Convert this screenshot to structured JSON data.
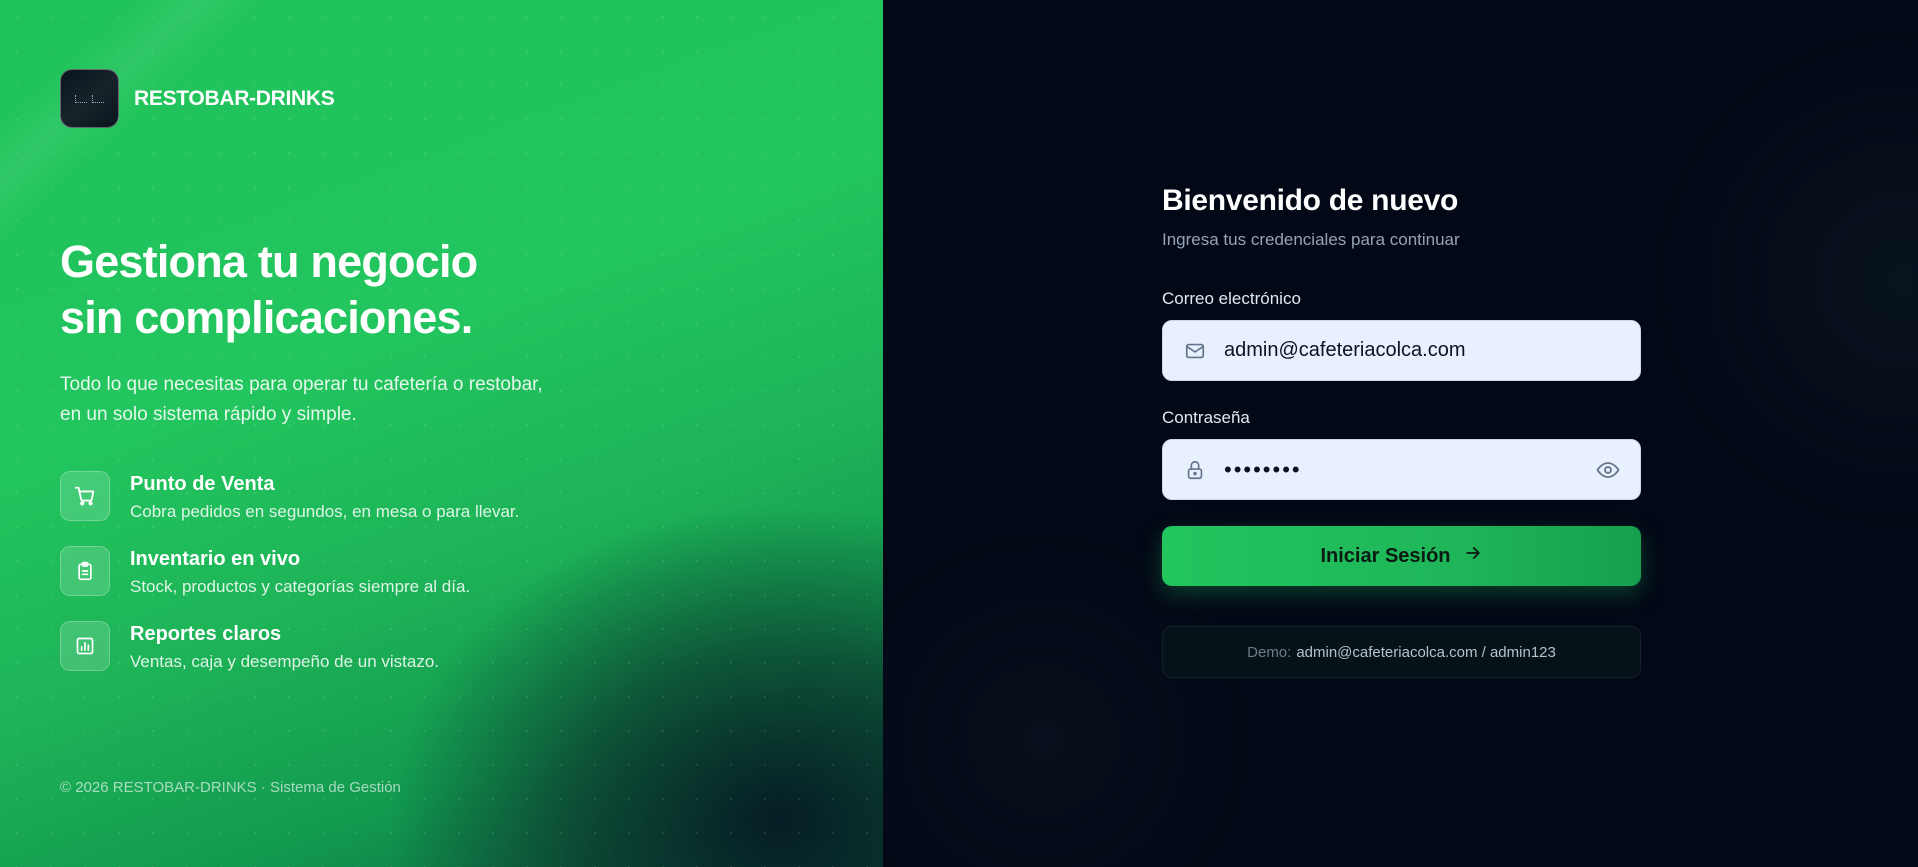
{
  "brand": {
    "name": "RESTOBAR-DRINKS"
  },
  "hero": {
    "title_line1": "Gestiona tu negocio",
    "title_line2": "sin complicaciones.",
    "subtitle_line1": "Todo lo que necesitas para operar tu cafetería o restobar,",
    "subtitle_line2": "en un solo sistema rápido y simple."
  },
  "features": [
    {
      "icon": "shopping-cart-icon",
      "title": "Punto de Venta",
      "description": "Cobra pedidos en segundos, en mesa o para llevar."
    },
    {
      "icon": "clipboard-icon",
      "title": "Inventario en vivo",
      "description": "Stock, productos y categorías siempre al día."
    },
    {
      "icon": "bar-chart-icon",
      "title": "Reportes claros",
      "description": "Ventas, caja y desempeño de un vistazo."
    }
  ],
  "footer": {
    "text": "© 2026 RESTOBAR-DRINKS · Sistema de Gestión"
  },
  "login": {
    "title": "Bienvenido de nuevo",
    "subtitle": "Ingresa tus credenciales para continuar",
    "email_label": "Correo electrónico",
    "email_value": "admin@cafeteriacolca.com",
    "password_label": "Contraseña",
    "password_masked": "••••••••",
    "submit_label": "Iniciar Sesión",
    "demo_label": "Demo:",
    "demo_value": "admin@cafeteriacolca.com / admin123"
  },
  "colors": {
    "accent": "#22c55e",
    "dark_background": "#030816",
    "input_background": "#e8f0fe"
  }
}
